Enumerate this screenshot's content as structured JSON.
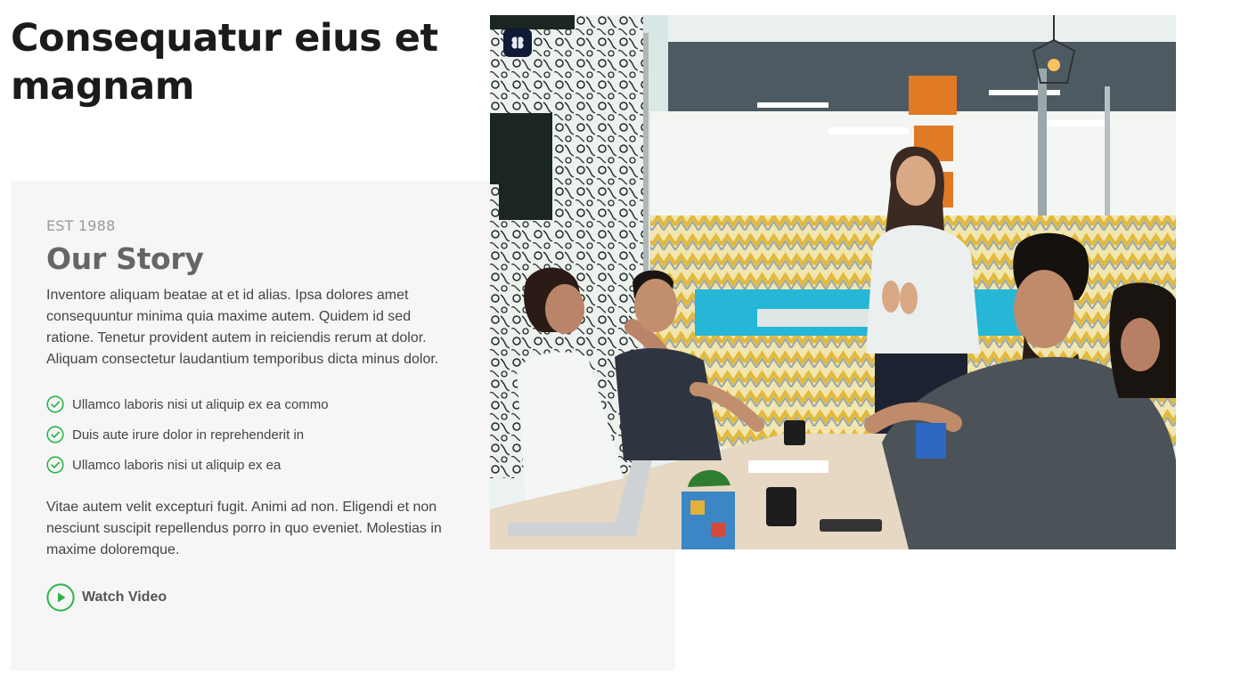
{
  "hero": {
    "title": "Consequatur eius et magnam"
  },
  "story": {
    "eyebrow": "EST 1988",
    "title": "Our Story",
    "paragraph1": "Inventore aliquam beatae at et id alias. Ipsa dolores amet consequuntur minima quia maxime autem. Quidem id sed ratione. Tenetur provident autem in reiciendis rerum at dolor. Aliquam consectetur laudantium temporibus dicta minus dolor.",
    "checklist": [
      "Ullamco laboris nisi ut aliquip ex ea commo",
      "Duis aute irure dolor in reprehenderit in",
      "Ullamco laboris nisi ut aliquip ex ea"
    ],
    "paragraph2": "Vitae autem velit excepturi fugit. Animi ad non. Eligendi et non nesciunt suscipit repellendus porro in quo eveniet. Molestias in maxime doloremque.",
    "watch_video_label": "Watch Video"
  },
  "icons": {
    "check": "check-circle-icon",
    "play": "play-circle-icon",
    "photo_badge": "brain-icon"
  },
  "colors": {
    "accent_green": "#2db34a",
    "card_background": "#f6f6f6",
    "heading_dark": "#1b1b1b"
  }
}
